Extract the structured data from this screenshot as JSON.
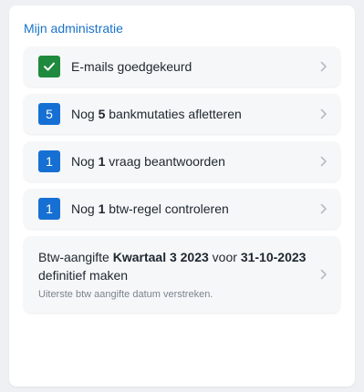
{
  "panel": {
    "title": "Mijn administratie"
  },
  "colors": {
    "title": "#1a73c9",
    "badge_green": "#1f8a3d",
    "badge_blue": "#1670d4",
    "card_bg": "#f6f7f8"
  },
  "items": [
    {
      "badge_icon": "check-icon",
      "badge_color": "green",
      "label": "E-mails goedgekeurd"
    },
    {
      "badge_text": "5",
      "badge_color": "blue",
      "prefix": "Nog ",
      "bold": "5",
      "suffix": " bankmutaties afletteren"
    },
    {
      "badge_text": "1",
      "badge_color": "blue",
      "prefix": "Nog ",
      "bold": "1",
      "suffix": " vraag beantwoorden"
    },
    {
      "badge_text": "1",
      "badge_color": "blue",
      "prefix": "Nog ",
      "bold": "1",
      "suffix": " btw-regel controleren"
    }
  ],
  "vat_task": {
    "part1": "Btw-aangifte ",
    "bold1": "Kwartaal 3 2023",
    "part2": " voor ",
    "bold2": "31-10-2023",
    "part3": " definitief maken",
    "subtext": "Uiterste btw aangifte datum verstreken."
  }
}
